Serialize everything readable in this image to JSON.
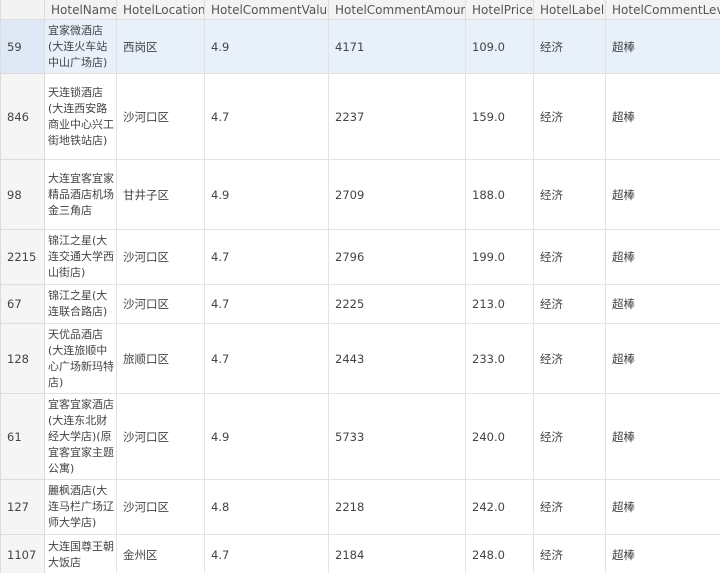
{
  "table": {
    "columns": [
      "",
      "HotelName",
      "HotelLocation",
      "HotelCommentValue",
      "HotelCommentAmount",
      "HotelPrice",
      "HotelLabel",
      "HotelCommentLeve"
    ],
    "rows": [
      {
        "idx": "59",
        "name": "宜家微酒店(大连火车站中山广场店)",
        "location": "西岗区",
        "value": "4.9",
        "amount": "4171",
        "price": "109.0",
        "label": "经济",
        "level": "超棒"
      },
      {
        "idx": "846",
        "name": "天连锁酒店(大连西安路商业中心兴工街地铁站店)",
        "location": "沙河口区",
        "value": "4.7",
        "amount": "2237",
        "price": "159.0",
        "label": "经济",
        "level": "超棒"
      },
      {
        "idx": "98",
        "name": "大连宜客宜家精品酒店机场金三角店",
        "location": "甘井子区",
        "value": "4.9",
        "amount": "2709",
        "price": "188.0",
        "label": "经济",
        "level": "超棒"
      },
      {
        "idx": "2215",
        "name": "锦江之星(大连交通大学西山街店)",
        "location": "沙河口区",
        "value": "4.7",
        "amount": "2796",
        "price": "199.0",
        "label": "经济",
        "level": "超棒"
      },
      {
        "idx": "67",
        "name": "锦江之星(大连联合路店)",
        "location": "沙河口区",
        "value": "4.7",
        "amount": "2225",
        "price": "213.0",
        "label": "经济",
        "level": "超棒"
      },
      {
        "idx": "128",
        "name": "天优品酒店(大连旅顺中心广场新玛特店)",
        "location": "旅顺口区",
        "value": "4.7",
        "amount": "2443",
        "price": "233.0",
        "label": "经济",
        "level": "超棒"
      },
      {
        "idx": "61",
        "name": "宜客宜家酒店(大连东北财经大学店)(原宜客宜家主题公寓)",
        "location": "沙河口区",
        "value": "4.9",
        "amount": "5733",
        "price": "240.0",
        "label": "经济",
        "level": "超棒"
      },
      {
        "idx": "127",
        "name": "麗枫酒店(大连马栏广场辽师大学店)",
        "location": "沙河口区",
        "value": "4.8",
        "amount": "2218",
        "price": "242.0",
        "label": "经济",
        "level": "超棒"
      },
      {
        "idx": "1107",
        "name": "大连国尊王朝大饭店",
        "location": "金州区",
        "value": "4.7",
        "amount": "2184",
        "price": "248.0",
        "label": "经济",
        "level": "超棒"
      }
    ]
  }
}
